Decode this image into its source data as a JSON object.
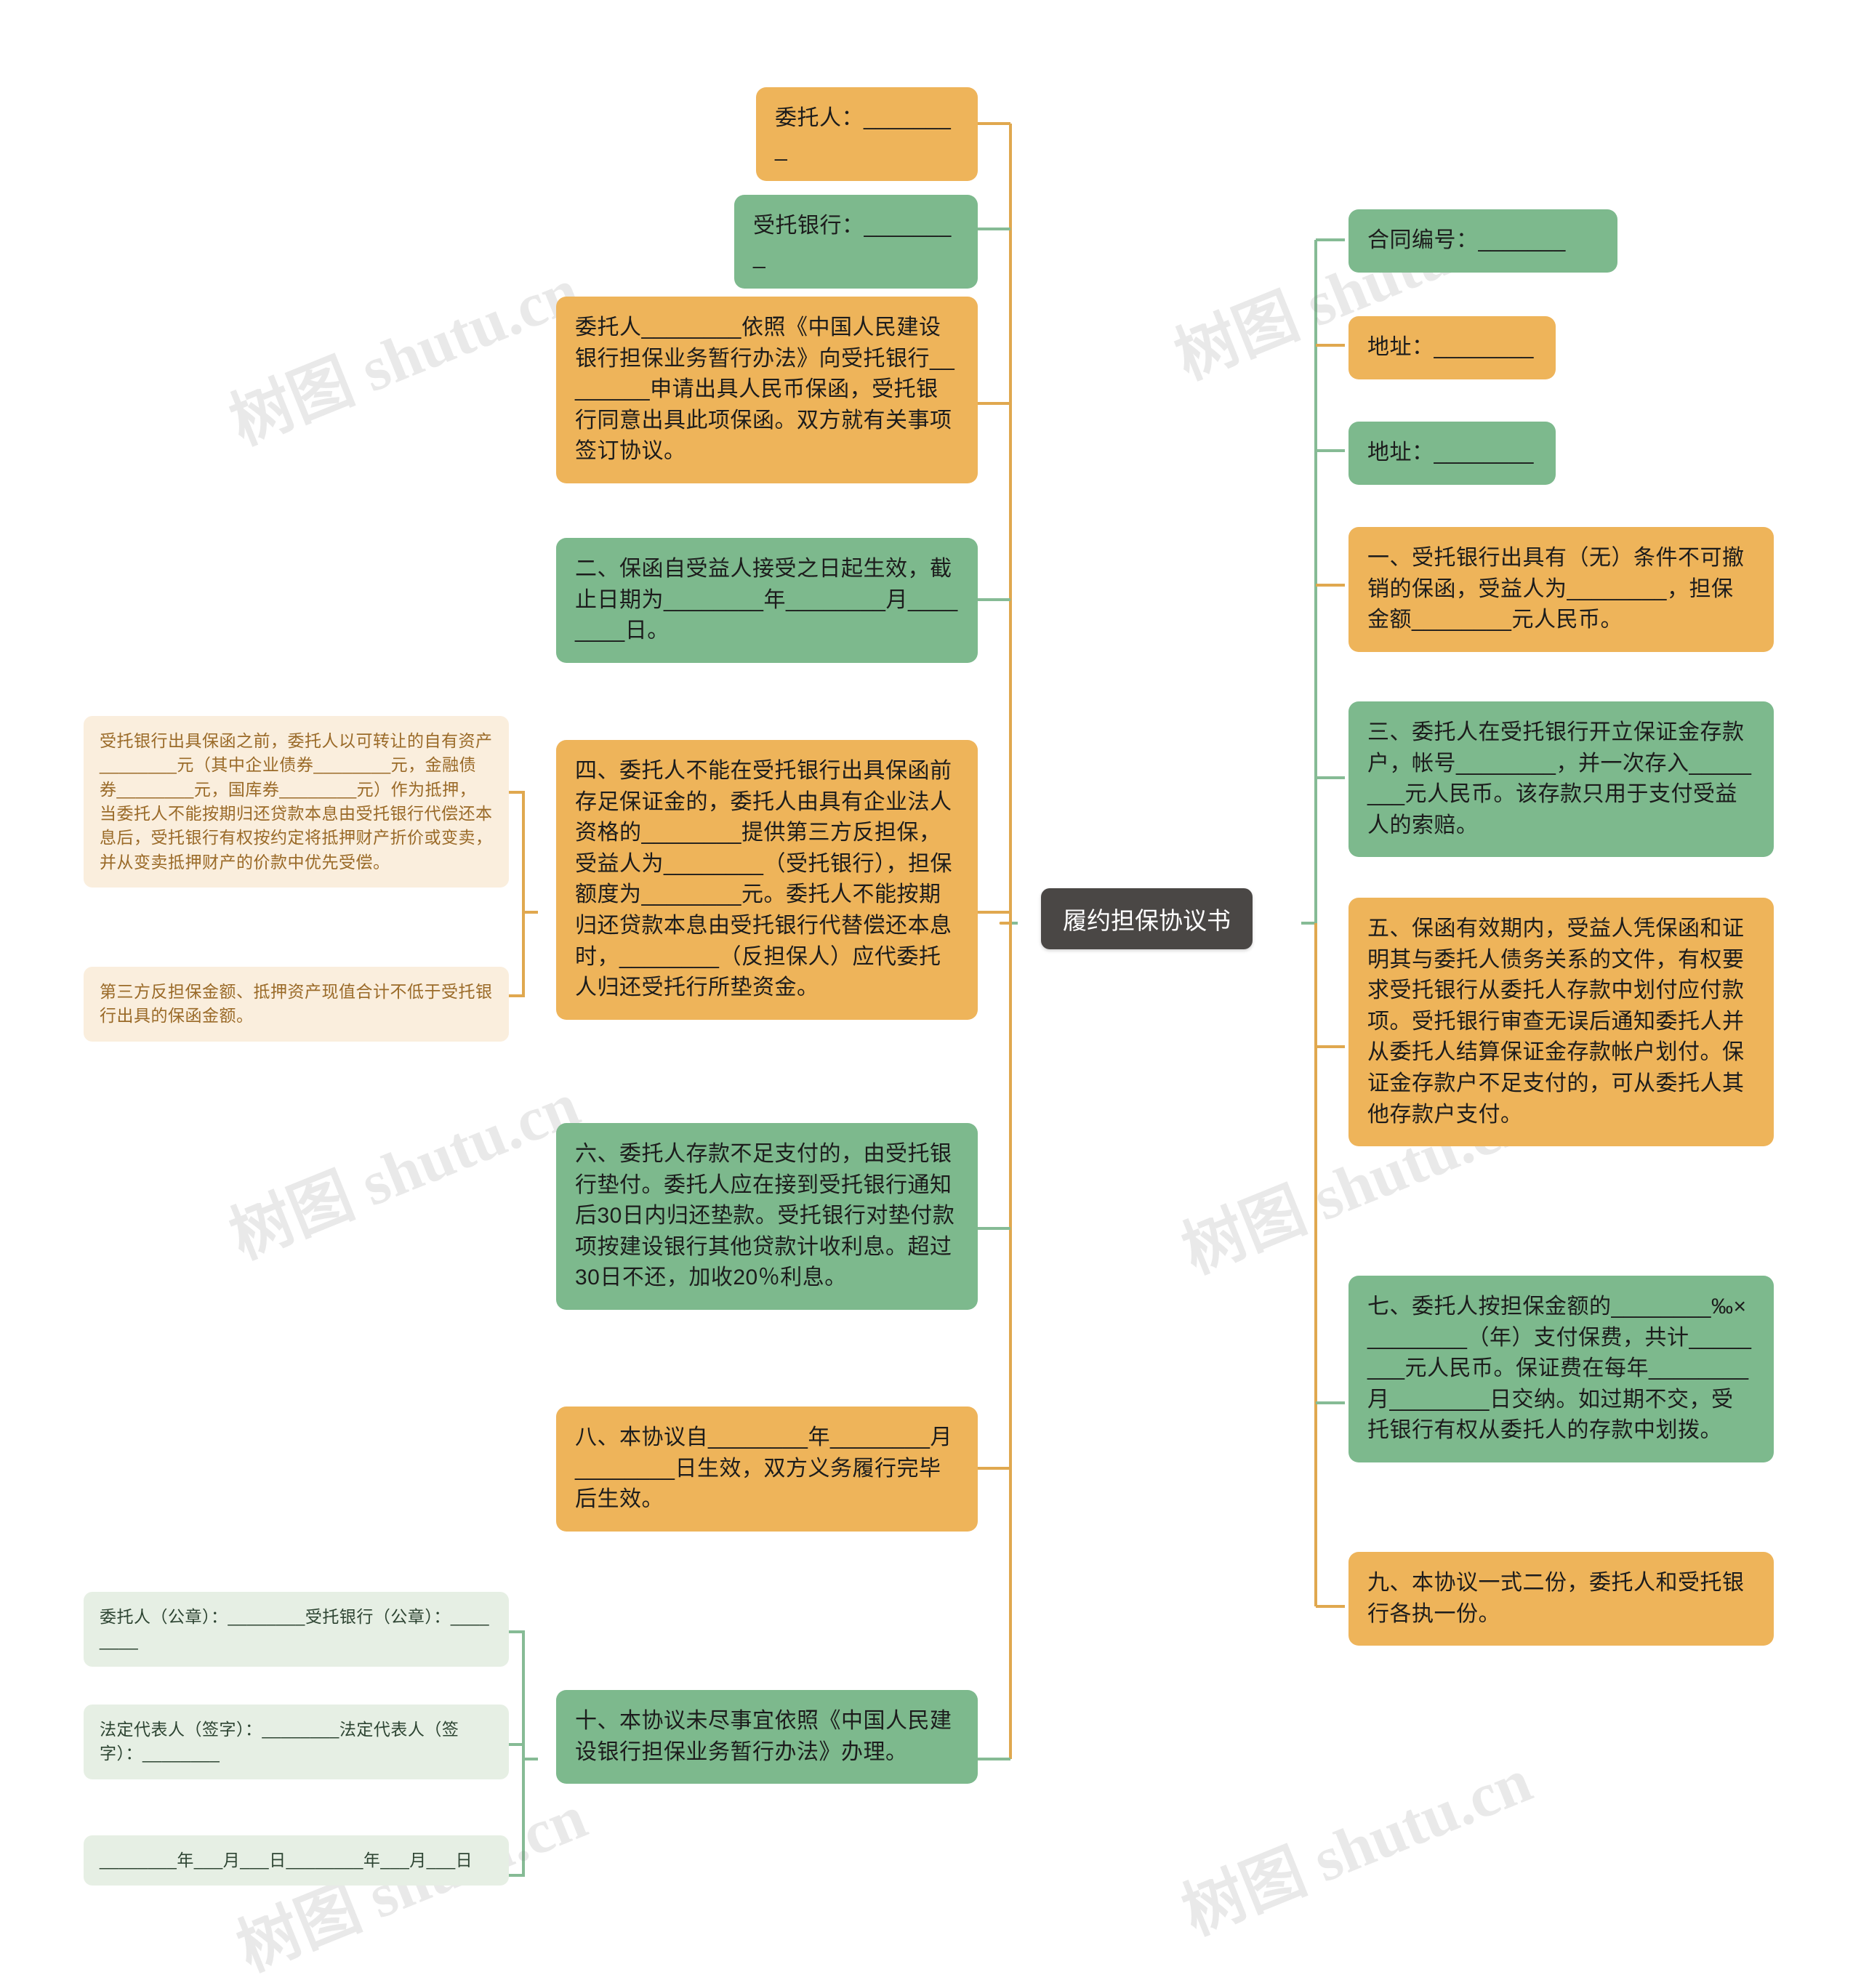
{
  "root": {
    "label": "履约担保协议书"
  },
  "watermark": {
    "text": "树图 shutu.cn"
  },
  "colors": {
    "orange": "#eeb45a",
    "green": "#7db98d",
    "pale_orange": "#faeedd",
    "pale_green": "#e6efe4",
    "root_bg": "#4a4745",
    "link_orange": "#e0a84f",
    "link_green": "#86bb95",
    "background": "#ffffff"
  },
  "left_branch": [
    {
      "id": "l1",
      "color": "orange",
      "text": "委托人：________"
    },
    {
      "id": "l2",
      "color": "green",
      "text": "受托银行：________"
    },
    {
      "id": "l3",
      "color": "orange",
      "text": "委托人________依照《中国人民建设银行担保业务暂行办法》向受托银行________申请出具人民币保函，受托银行同意出具此项保函。双方就有关事项签订协议。"
    },
    {
      "id": "l4",
      "color": "green",
      "text": "二、保函自受益人接受之日起生效，截止日期为________年________月________日。"
    },
    {
      "id": "l5",
      "color": "orange",
      "text": "四、委托人不能在受托银行出具保函前存足保证金的，委托人由具有企业法人资格的________提供第三方反担保，受益人为________（受托银行），担保额度为________元。委托人不能按期归还贷款本息由受托银行代替偿还本息时，________（反担保人）应代委托人归还受托行所垫资金。"
    },
    {
      "id": "l6",
      "color": "green",
      "text": "六、委托人存款不足支付的，由受托银行垫付。委托人应在接到受托银行通知后30日内归还垫款。受托银行对垫付款项按建设银行其他贷款计收利息。超过30日不还，加收20％利息。"
    },
    {
      "id": "l7",
      "color": "orange",
      "text": "八、本协议自________年________月________日生效，双方义务履行完毕后生效。"
    },
    {
      "id": "l8",
      "color": "green",
      "text": "十、本协议未尽事宜依照《中国人民建设银行担保业务暂行办法》办理。"
    }
  ],
  "left_sub_of_l5": [
    {
      "id": "s1",
      "color": "pale_orange",
      "text": "受托银行出具保函之前，委托人以可转让的自有资产________元（其中企业债券________元，金融债券________元，国库券________元）作为抵押，当委托人不能按期归还贷款本息由受托银行代偿还本息后，受托银行有权按约定将抵押财产折价或变卖，并从变卖抵押财产的价款中优先受偿。"
    },
    {
      "id": "s2",
      "color": "pale_orange",
      "text": "第三方反担保金额、抵押资产现值合计不低于受托银行出具的保函金额。"
    }
  ],
  "left_sub_of_l8": [
    {
      "id": "s3",
      "color": "pale_green",
      "text": "委托人（公章）：________受托银行（公章）：________"
    },
    {
      "id": "s4",
      "color": "pale_green",
      "text": "法定代表人（签字）：________法定代表人（签字）：________"
    },
    {
      "id": "s5",
      "color": "pale_green",
      "text": "________年___月___日________年___月___日"
    }
  ],
  "right_branch": [
    {
      "id": "r1",
      "color": "green",
      "text": "合同编号：_______"
    },
    {
      "id": "r2",
      "color": "orange",
      "text": "地址：________"
    },
    {
      "id": "r3",
      "color": "green",
      "text": "地址：________"
    },
    {
      "id": "r4",
      "color": "orange",
      "text": "一、受托银行出具有（无）条件不可撤销的保函，受益人为________，担保金额________元人民币。"
    },
    {
      "id": "r5",
      "color": "green",
      "text": "三、委托人在受托银行开立保证金存款户，帐号________，并一次存入________元人民币。该存款只用于支付受益人的索赔。"
    },
    {
      "id": "r6",
      "color": "orange",
      "text": "五、保函有效期内，受益人凭保函和证明其与委托人债务关系的文件，有权要求受托银行从委托人存款中划付应付款项。受托银行审查无误后通知委托人并从委托人结算保证金存款帐户划付。保证金存款户不足支付的，可从委托人其他存款户支付。"
    },
    {
      "id": "r7",
      "color": "green",
      "text": "七、委托人按担保金额的________‰×________（年）支付保费，共计________元人民币。保证费在每年________月________日交纳。如过期不交，受托银行有权从委托人的存款中划拨。"
    },
    {
      "id": "r8",
      "color": "orange",
      "text": "九、本协议一式二份，委托人和受托银行各执一份。"
    }
  ]
}
